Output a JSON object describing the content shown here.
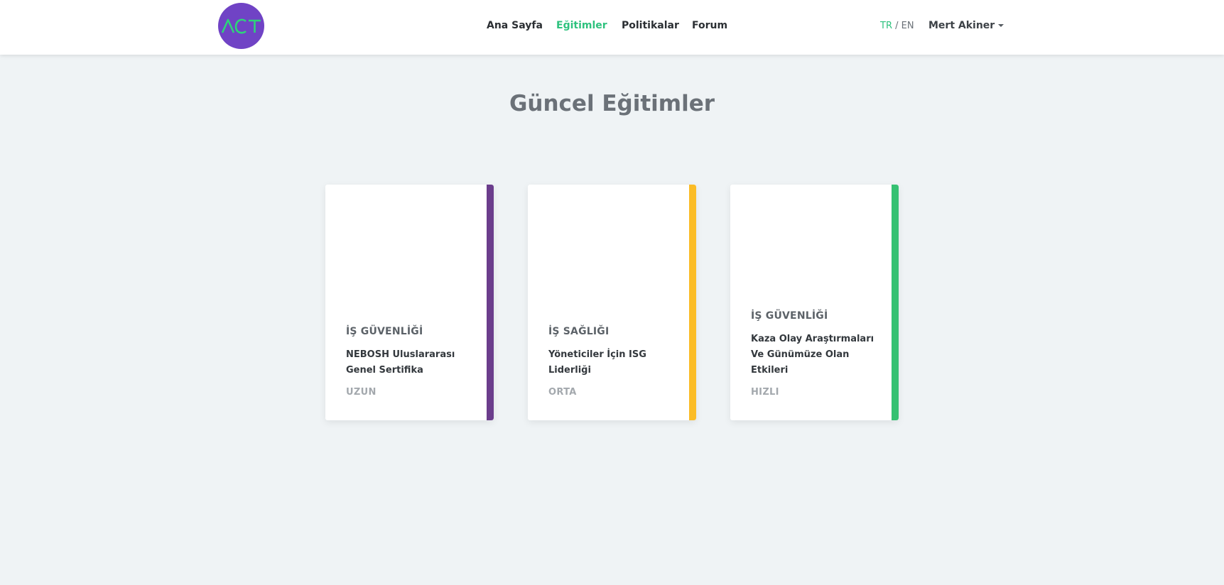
{
  "header": {
    "logo_text": "ACT",
    "nav": [
      {
        "label": "Ana Sayfa",
        "active": false
      },
      {
        "label": "Eğitimler",
        "active": true
      },
      {
        "label": "Politikalar",
        "active": false
      },
      {
        "label": "Forum",
        "active": false
      }
    ],
    "lang": {
      "tr": "TR",
      "separator": " / ",
      "en": "EN",
      "active": "TR"
    },
    "user_name": "Mert Akiner"
  },
  "main": {
    "title": "Güncel Eğitimler",
    "cards": [
      {
        "category": "İŞ GÜVENLİĞİ",
        "title": "NEBOSH Uluslararası Genel Sertifika",
        "duration": "UZUN",
        "accent": "#6b3d8c"
      },
      {
        "category": "İŞ SAĞLIĞI",
        "title": "Yöneticiler İçin ISG Liderliği",
        "duration": "ORTA",
        "accent": "#fbbc26"
      },
      {
        "category": "İŞ GÜVENLİĞİ",
        "title": "Kaza Olay Araştırmaları Ve Günümüze Olan Etkileri",
        "duration": "HIZLI",
        "accent": "#36c172"
      }
    ]
  },
  "colors": {
    "brand_purple": "#7043c5",
    "accent_green": "#2ec27e",
    "background": "#eff3f5"
  }
}
